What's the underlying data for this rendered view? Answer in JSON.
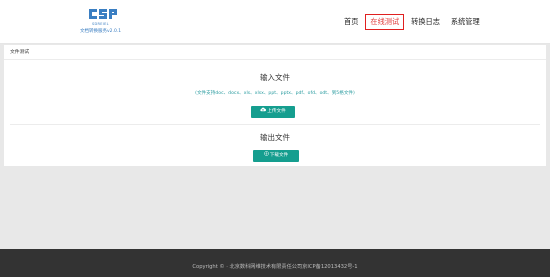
{
  "header": {
    "logo": {
      "mark_color": "#3a7ec2",
      "small_text": "SDREIEL",
      "sub_text": "文档转换服务v2.0.1"
    },
    "nav": [
      {
        "label": "首页",
        "active": false
      },
      {
        "label": "在线测试",
        "active": true
      },
      {
        "label": "转换日志",
        "active": false
      },
      {
        "label": "系统管理",
        "active": false
      }
    ]
  },
  "panel": {
    "title": "文件测试",
    "input_section": {
      "title": "输入文件",
      "hint": "(文件支持doc、docx、xls、xlsx、ppt、pptx、pdf、ofd、odt、到5格文件)",
      "upload_button": "上传文件"
    },
    "output_section": {
      "title": "输出文件",
      "download_button": "下载文件"
    }
  },
  "footer": {
    "text": "Copyright © · 北京数科网维技术有限责任公司京ICP备12013432号-1"
  },
  "colors": {
    "button": "#159e8f",
    "hint": "#2b9ca0",
    "active_nav": "#e02020",
    "footer_bg": "#333333"
  }
}
